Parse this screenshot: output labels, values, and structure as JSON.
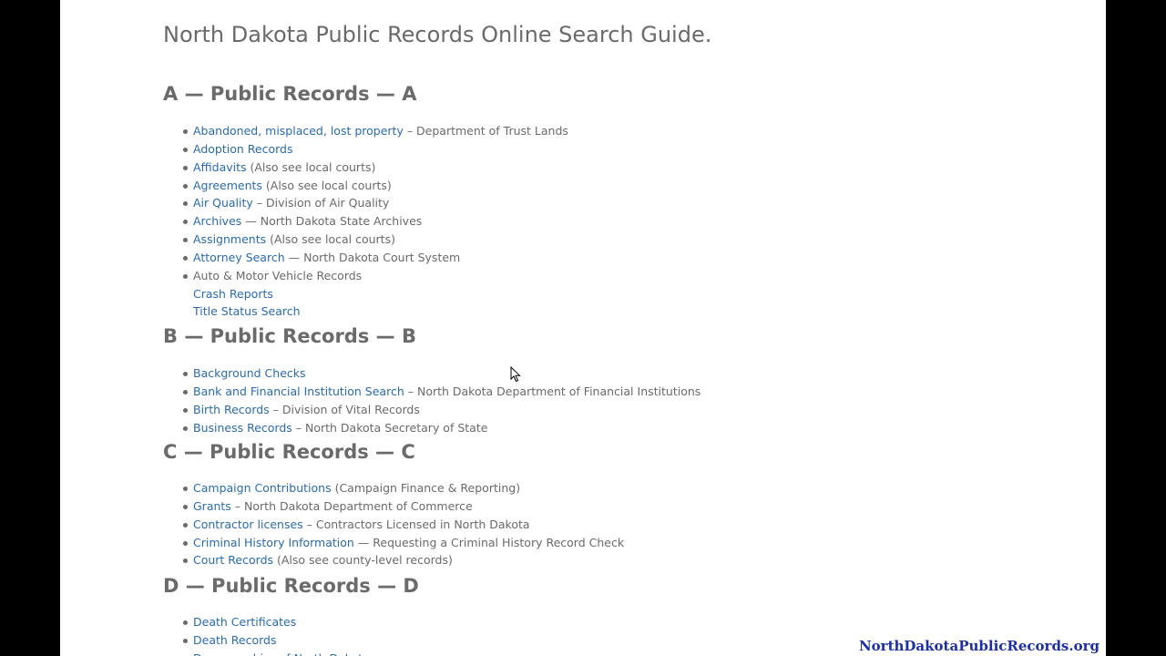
{
  "page": {
    "title": "North Dakota Public Records Online Search Guide."
  },
  "sections": [
    {
      "heading": "A — Public Records — A",
      "items": [
        {
          "link": "Abandoned, misplaced, lost property",
          "suffix": " – Department of Trust Lands"
        },
        {
          "link": "Adoption Records",
          "suffix": ""
        },
        {
          "link": "Affidavits",
          "suffix": " (Also see local courts)"
        },
        {
          "link": "Agreements",
          "suffix": " (Also see local courts)"
        },
        {
          "link": "Air Quality",
          "suffix": " – Division of Air Quality"
        },
        {
          "link": "Archives",
          "suffix": " — North Dakota State Archives"
        },
        {
          "link": "Assignments",
          "suffix": " (Also see local courts)"
        },
        {
          "link": "Attorney Search",
          "suffix": " — North Dakota Court System"
        },
        {
          "link": "",
          "suffix": "Auto & Motor Vehicle Records"
        },
        {
          "link": "Crash Reports",
          "suffix": "",
          "sub": true
        },
        {
          "link": "Title Status Search",
          "suffix": "",
          "sub": true
        }
      ]
    },
    {
      "heading": "B — Public Records — B",
      "items": [
        {
          "link": "Background Checks",
          "suffix": ""
        },
        {
          "link": "Bank and Financial Institution Search",
          "suffix": " – North Dakota Department of Financial Institutions"
        },
        {
          "link": "Birth Records",
          "suffix": " – Division of Vital Records"
        },
        {
          "link": "Business Records",
          "suffix": " – North Dakota Secretary of State"
        }
      ]
    },
    {
      "heading": "C — Public Records — C",
      "items": [
        {
          "link": "Campaign Contributions",
          "suffix": " (Campaign Finance & Reporting)"
        },
        {
          "link": "Grants",
          "suffix": " – North Dakota Department of Commerce"
        },
        {
          "link": "Contractor licenses",
          "suffix": " – Contractors Licensed in North Dakota"
        },
        {
          "link": "Criminal History Information",
          "suffix": " — Requesting a Criminal History Record Check"
        },
        {
          "link": "Court Records",
          "suffix": " (Also see county-level records)"
        }
      ]
    },
    {
      "heading": "D — Public Records — D",
      "items": [
        {
          "link": "Death Certificates",
          "suffix": ""
        },
        {
          "link": "Death Records",
          "suffix": ""
        },
        {
          "link": "Demographics of North Dakota",
          "suffix": ""
        }
      ]
    }
  ],
  "watermark": "NorthDakotaPublicRecords.org",
  "cursor_icon": "mouse-pointer-icon"
}
